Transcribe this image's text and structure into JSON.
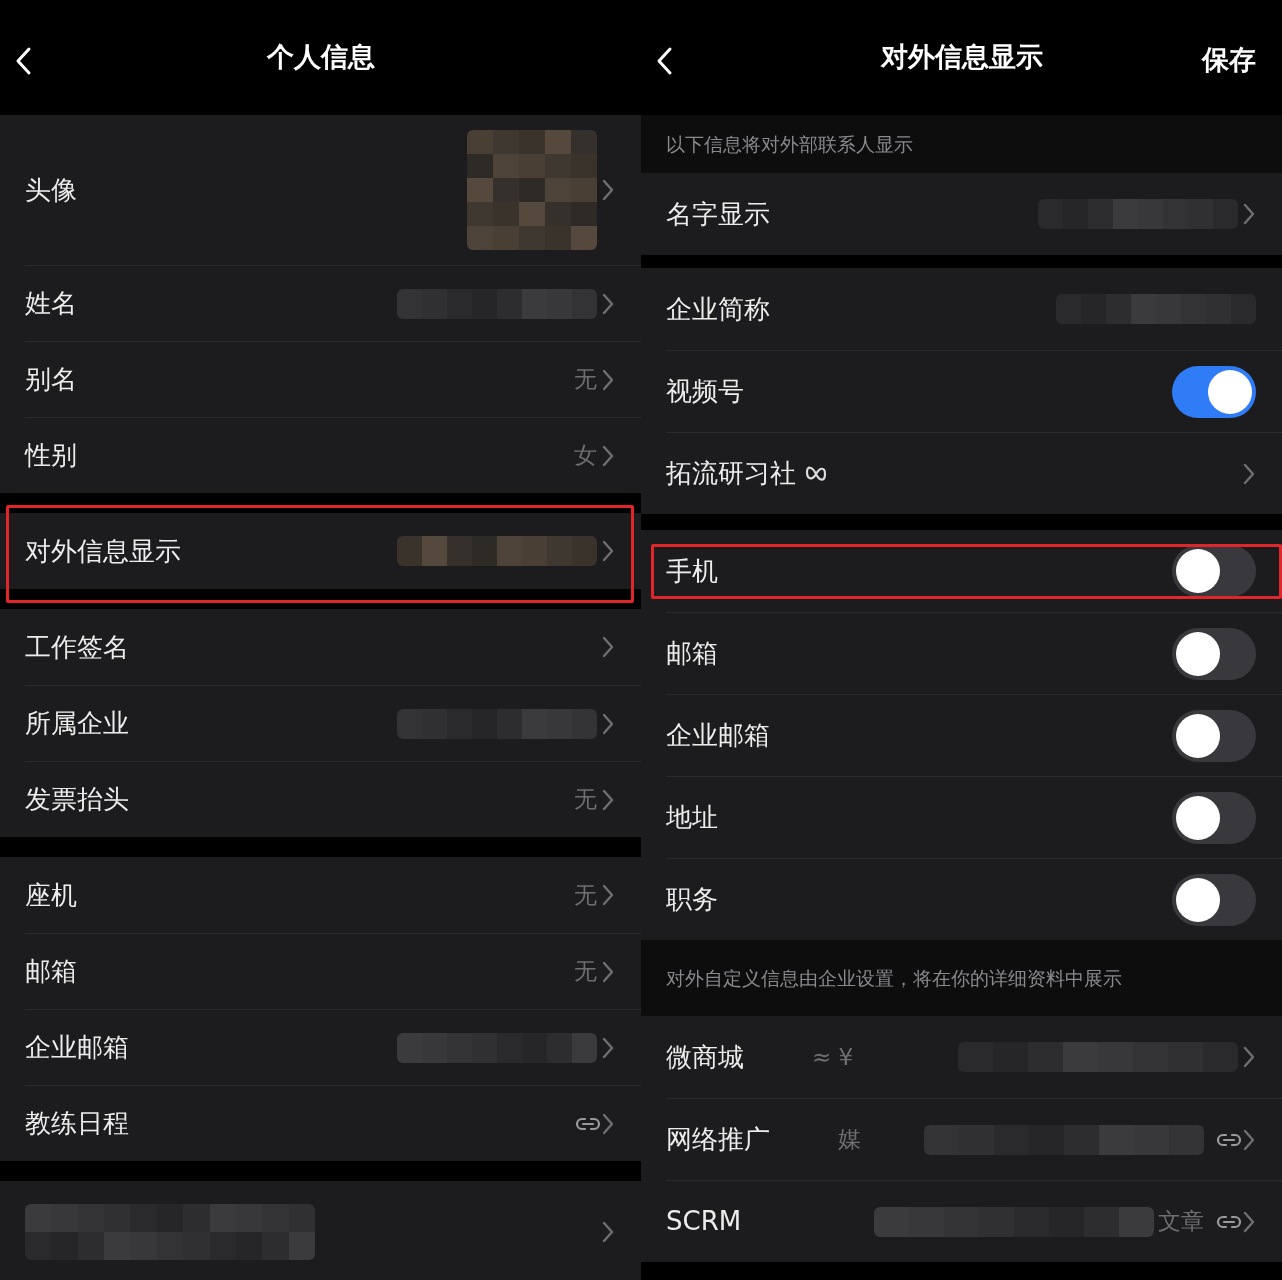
{
  "panels": [
    {
      "title": "个人信息",
      "sections": [
        {
          "rows": [
            {
              "kind": "avatar",
              "label": "头像",
              "redacted": true,
              "highlighted": false
            },
            {
              "kind": "nav",
              "label": "姓名",
              "redacted": true,
              "highlighted": false
            },
            {
              "kind": "nav",
              "label": "别名",
              "value": "无",
              "highlighted": false
            },
            {
              "kind": "nav",
              "label": "性别",
              "value": "女",
              "highlighted": false
            }
          ]
        },
        {
          "rows": [
            {
              "kind": "nav",
              "label": "对外信息显示",
              "redacted": true,
              "highlighted": true
            }
          ]
        },
        {
          "rows": [
            {
              "kind": "nav",
              "label": "工作签名",
              "highlighted": false
            },
            {
              "kind": "nav",
              "label": "所属企业",
              "redacted": true,
              "highlighted": false
            },
            {
              "kind": "nav",
              "label": "发票抬头",
              "value": "无",
              "highlighted": false
            }
          ]
        },
        {
          "rows": [
            {
              "kind": "nav",
              "label": "座机",
              "value": "无",
              "highlighted": false
            },
            {
              "kind": "nav",
              "label": "邮箱",
              "value": "无",
              "highlighted": false
            },
            {
              "kind": "nav",
              "label": "企业邮箱",
              "redacted": true,
              "highlighted": false
            },
            {
              "kind": "nav",
              "label": "教练日程",
              "link": true,
              "highlighted": false
            }
          ]
        },
        {
          "rows": [
            {
              "kind": "hidden",
              "redacted": true,
              "highlighted": false
            }
          ]
        }
      ]
    },
    {
      "title": "对外信息显示",
      "action": "保存",
      "sections": [
        {
          "note": "以下信息将对外部联系人显示",
          "rows": [
            {
              "kind": "nav",
              "label": "名字显示",
              "redacted": true,
              "highlighted": false
            }
          ]
        },
        {
          "rows": [
            {
              "kind": "plain",
              "label": "企业简称",
              "redacted": true,
              "highlighted": false
            },
            {
              "kind": "toggle",
              "label": "视频号",
              "on": true,
              "highlighted": false
            },
            {
              "kind": "nav",
              "label": "拓流研习社",
              "has_icon": true,
              "highlighted": false
            }
          ]
        },
        {
          "rows": [
            {
              "kind": "toggle",
              "label": "手机",
              "on": false,
              "highlighted": true
            },
            {
              "kind": "toggle",
              "label": "邮箱",
              "on": false,
              "highlighted": false
            },
            {
              "kind": "toggle",
              "label": "企业邮箱",
              "on": false,
              "highlighted": false
            },
            {
              "kind": "toggle",
              "label": "地址",
              "on": false,
              "highlighted": false
            },
            {
              "kind": "toggle",
              "label": "职务",
              "on": false,
              "highlighted": false
            }
          ]
        },
        {
          "note": "对外自定义信息由企业设置，将在你的详细资料中展示",
          "rows": [
            {
              "kind": "nav",
              "label": "微商城",
              "value": "≈ ¥",
              "redacted": true,
              "highlighted": false
            },
            {
              "kind": "nav",
              "label": "网络推广",
              "value": "媒",
              "redacted": true,
              "link": true,
              "highlighted": false
            },
            {
              "kind": "nav",
              "label": "SCRM",
              "redacted": true,
              "value_end": "文章",
              "link": true,
              "highlighted": false
            }
          ]
        }
      ]
    }
  ]
}
